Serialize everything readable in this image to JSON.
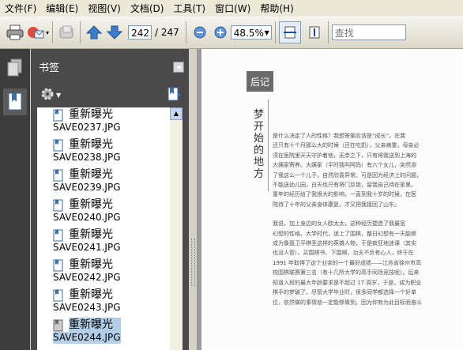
{
  "menu": [
    "文件(F)",
    "编辑(E)",
    "视图(V)",
    "文档(D)",
    "工具(T)",
    "窗口(W)",
    "帮助(H)"
  ],
  "toolbar": {
    "current_page": "242",
    "total_pages": "/ 247",
    "zoom": "48.5%",
    "search_placeholder": "查找"
  },
  "panel": {
    "title": "书签",
    "bookmarks": [
      {
        "title": "重新曝光",
        "file": "SAVE0237.JPG"
      },
      {
        "title": "重新曝光",
        "file": "SAVE0238.JPG"
      },
      {
        "title": "重新曝光",
        "file": "SAVE0239.JPG"
      },
      {
        "title": "重新曝光",
        "file": "SAVE0240.JPG"
      },
      {
        "title": "重新曝光",
        "file": "SAVE0241.JPG"
      },
      {
        "title": "重新曝光",
        "file": "SAVE0242.JPG"
      },
      {
        "title": "重新曝光",
        "file": "SAVE0243.JPG"
      },
      {
        "title": "重新曝光",
        "file": "SAVE0244.JPG"
      }
    ]
  },
  "doc": {
    "chip": "后记",
    "vertical_title": "梦开始的地方",
    "lines": [
      "是什么决定了人的性格？我想答案应该是“成长”。在我",
      "还只有十个月那么大的时候（还在吃奶），父亲病重，母亲必",
      "须在医院里天天守护着他，无奈之下，只有将我送到上海的",
      "大姨家寄养。大姨家（平时我叫阿妈）有六个女儿，突然添",
      "了我这么一个儿子，自然欣喜异常。可是因为经济上的问题，",
      "不能送幼儿园，白天也只有将门反锁，留我自己待在家里。",
      "童年的经历给了我很大的影响，一直到我十岁的时候，在医",
      "院待了十年的父亲身体康复，才又把我接回了山东。",
      "我说，加上身边的女人欧太太，这种经历塑造了我最宽",
      "幻想的性格。大学时代，迷上了围棋，整日幻想有一天能够",
      "成为像聂卫平棋圣这样的英雄人物，于是疯狂地迷课（其实",
      "也没人管），买围棋书、下围棋，功夫不负有心人，终于在",
      "1991 年取得了这个业余的一个最好成绩——江苏省徐州市高",
      "校围棋联赛第三名（有十几所大学的高手同场竞技呢）。后来",
      "知道入段的最大年龄要求是不超过 17 周岁，于是，成为职业",
      "棋手的梦破了。尽管大学毕业时，很多同学都选择一个好单",
      "位，依然做的事情就一定能够做到，因为你有为此目标而奋斗"
    ]
  },
  "colors": {
    "panel_bg": "#4a4a4a",
    "selected": "#b3cfe8",
    "toolbar": "#ece9d8"
  }
}
